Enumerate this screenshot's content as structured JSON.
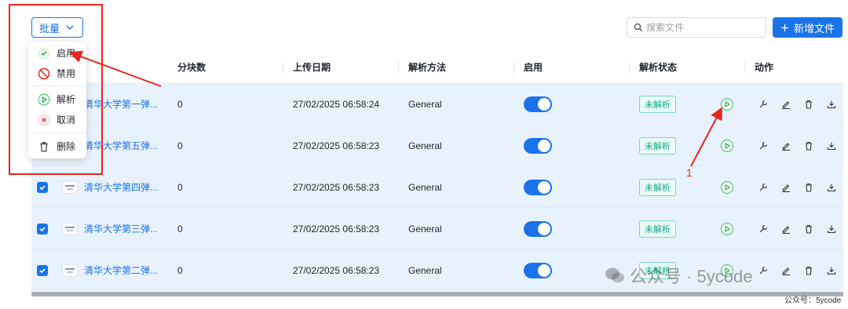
{
  "toolbar": {
    "bulk_label": "批量",
    "search_placeholder": "搜索文件",
    "new_file_label": "新增文件"
  },
  "table": {
    "columns": [
      "分块数",
      "上传日期",
      "解析方法",
      "启用",
      "解析状态",
      "动作"
    ],
    "rows": [
      {
        "name": "清华大学第一弹...",
        "chunks": "0",
        "date": "27/02/2025 06:58:24",
        "method": "General",
        "status": "未解析",
        "enabled": true,
        "checked": true
      },
      {
        "name": "清华大学第五弹...",
        "chunks": "0",
        "date": "27/02/2025 06:58:23",
        "method": "General",
        "status": "未解析",
        "enabled": true,
        "checked": true
      },
      {
        "name": "清华大学第四弹...",
        "chunks": "0",
        "date": "27/02/2025 06:58:23",
        "method": "General",
        "status": "未解析",
        "enabled": true,
        "checked": true
      },
      {
        "name": "清华大学第三弹...",
        "chunks": "0",
        "date": "27/02/2025 06:58:23",
        "method": "General",
        "status": "未解析",
        "enabled": true,
        "checked": true
      },
      {
        "name": "清华大学第二弹...",
        "chunks": "0",
        "date": "27/02/2025 06:58:23",
        "method": "General",
        "status": "未解析",
        "enabled": true,
        "checked": true
      }
    ]
  },
  "bulk_menu": {
    "items": [
      {
        "label": "启用",
        "icon": "check-circle-icon"
      },
      {
        "label": "禁用",
        "icon": "forbidden-icon"
      },
      {
        "label": "解析",
        "icon": "play-circle-icon"
      },
      {
        "label": "取消",
        "icon": "cancel-circle-icon"
      },
      {
        "label": "删除",
        "icon": "trash-icon"
      }
    ]
  },
  "annotation": {
    "number": "1"
  },
  "watermark": {
    "main": "公众号 · 5ycode",
    "corner": "公众号：5ycode"
  },
  "colors": {
    "accent": "#1a73e8",
    "annotation": "#e8251e",
    "status_green": "#13a987",
    "row_selected": "#e8f2fc"
  }
}
